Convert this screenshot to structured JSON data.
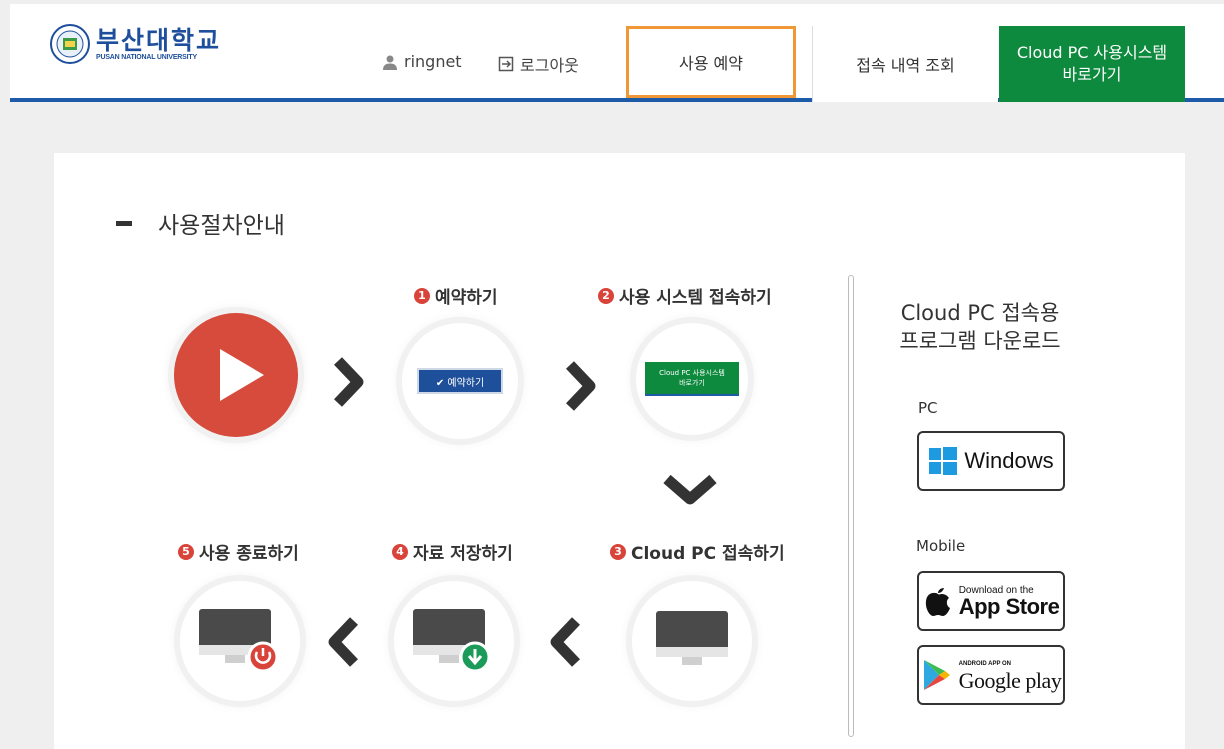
{
  "header": {
    "logo_ko": "부산대학교",
    "logo_en": "PUSAN NATIONAL UNIVERSITY",
    "username": "ringnet",
    "logout_label": "로그아웃",
    "nav": {
      "reserve": "사용 예약",
      "history": "접속 내역 조회",
      "cloud_line1": "Cloud PC 사용시스템",
      "cloud_line2": "바로가기"
    }
  },
  "guide": {
    "title": "사용절차안내",
    "steps": [
      {
        "num": "1",
        "label": "예약하기",
        "button": "✔ 예약하기"
      },
      {
        "num": "2",
        "label": "사용 시스템 접속하기",
        "button_line1": "Cloud PC 사용시스템",
        "button_line2": "바로가기"
      },
      {
        "num": "3",
        "label": "Cloud PC 접속하기"
      },
      {
        "num": "4",
        "label": "자료 저장하기"
      },
      {
        "num": "5",
        "label": "사용 종료하기"
      }
    ]
  },
  "download": {
    "title_line1": "Cloud PC 접속용",
    "title_line2": "프로그램 다운로드",
    "pc_label": "PC",
    "windows_label": "Windows",
    "mobile_label": "Mobile",
    "appstore_small": "Download on the",
    "appstore_large": "App Store",
    "googleplay_small": "ANDROID APP ON",
    "googleplay_large": "Google play"
  },
  "colors": {
    "brand_blue": "#1d5aa8",
    "cloud_green": "#0d8a3d",
    "highlight_orange": "#f09838",
    "play_red": "#d64b3c"
  }
}
